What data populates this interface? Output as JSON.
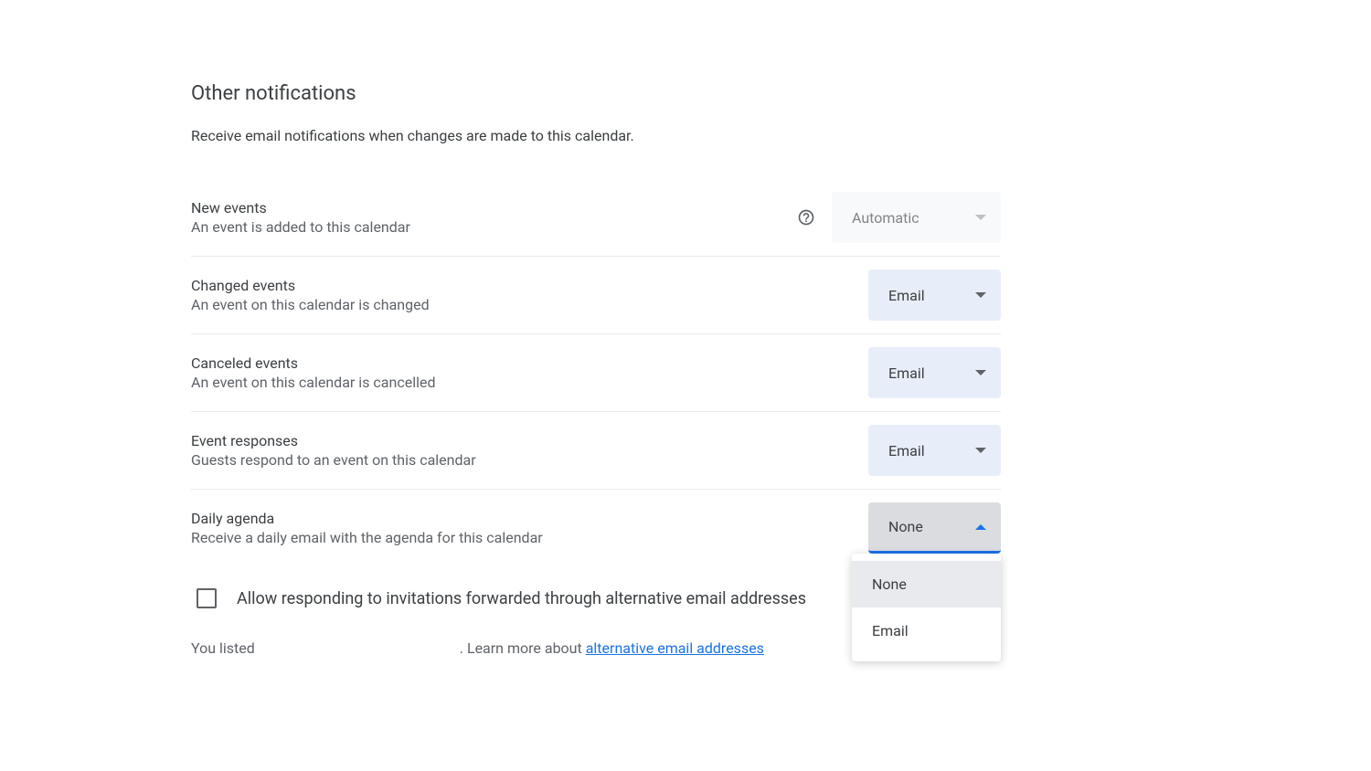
{
  "section": {
    "title": "Other notifications",
    "description": "Receive email notifications when changes are made to this calendar."
  },
  "settings": [
    {
      "label": "New events",
      "sub": "An event is added to this calendar",
      "has_help": true,
      "value": "Automatic",
      "disabled": true,
      "open": false
    },
    {
      "label": "Changed events",
      "sub": "An event on this calendar is changed",
      "has_help": false,
      "value": "Email",
      "disabled": false,
      "open": false
    },
    {
      "label": "Canceled events",
      "sub": "An event on this calendar is cancelled",
      "has_help": false,
      "value": "Email",
      "disabled": false,
      "open": false
    },
    {
      "label": "Event responses",
      "sub": "Guests respond to an event on this calendar",
      "has_help": false,
      "value": "Email",
      "disabled": false,
      "open": false
    },
    {
      "label": "Daily agenda",
      "sub": "Receive a daily email with the agenda for this calendar",
      "has_help": false,
      "value": "None",
      "disabled": false,
      "open": true
    }
  ],
  "dropdown_menu": {
    "options": [
      "None",
      "Email"
    ],
    "selected": "None"
  },
  "checkbox": {
    "label": "Allow responding to invitations forwarded through alternative email addresses",
    "checked": false
  },
  "listed": {
    "prefix": "You listed",
    "redacted": " ",
    "suffix": ". Learn more about ",
    "link": "alternative email addresses"
  }
}
